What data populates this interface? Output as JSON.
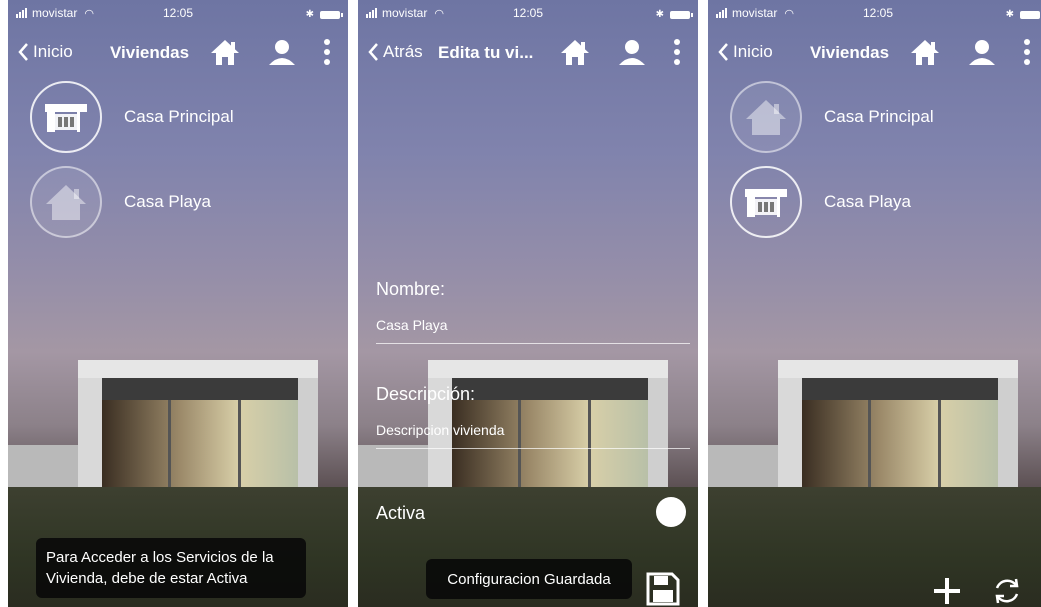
{
  "status": {
    "carrier": "movistar",
    "time": "12:05"
  },
  "screens": [
    {
      "back_label": "Inicio",
      "title": "Viviendas",
      "items": [
        {
          "label": "Casa Principal",
          "icon": "modern-house-icon",
          "active": true
        },
        {
          "label": "Casa Playa",
          "icon": "house-icon",
          "active": false
        }
      ],
      "toast": "Para Acceder a los Servicios de la Vivienda, debe de estar Activa"
    },
    {
      "back_label": "Atrás",
      "title": "Edita tu vi...",
      "nombre_label": "Nombre:",
      "nombre_value": "Casa Playa",
      "descripcion_label": "Descripción:",
      "descripcion_value": "Descripcion vivienda",
      "activa_label": "Activa",
      "toast": "Configuracion Guardada"
    },
    {
      "back_label": "Inicio",
      "title": "Viviendas",
      "items": [
        {
          "label": "Casa Principal",
          "icon": "house-icon",
          "active": false
        },
        {
          "label": "Casa Playa",
          "icon": "modern-house-icon",
          "active": true
        }
      ]
    }
  ],
  "colors": {
    "sky_top": "#6e75a3",
    "toast_bg": "#0a0a0a",
    "text": "#ffffff"
  }
}
